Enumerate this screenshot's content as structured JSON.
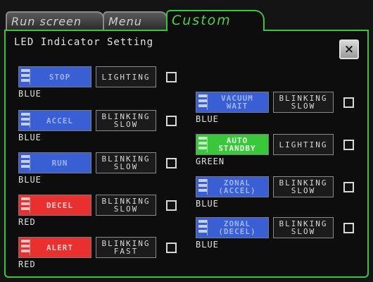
{
  "tabs": [
    {
      "label": "Run screen"
    },
    {
      "label": "Menu"
    },
    {
      "label": "Custom"
    }
  ],
  "panel": {
    "title": "LED Indicator Setting",
    "close_label": "×"
  },
  "left_column": [
    {
      "name": "STOP",
      "mode": "LIGHTING",
      "color": "BLUE",
      "swatch": "#3a5fd4",
      "checked": false
    },
    {
      "name": "ACCEL",
      "mode": "BLINKING\nSLOW",
      "color": "BLUE",
      "swatch": "#3a5fd4",
      "checked": false
    },
    {
      "name": "RUN",
      "mode": "BLINKING\nSLOW",
      "color": "BLUE",
      "swatch": "#3a5fd4",
      "checked": false
    },
    {
      "name": "DECEL",
      "mode": "BLINKING\nSLOW",
      "color": "RED",
      "swatch": "#ea2f2f",
      "checked": false
    },
    {
      "name": "ALERT",
      "mode": "BLINKING\nFAST",
      "color": "RED",
      "swatch": "#ea2f2f",
      "checked": false
    }
  ],
  "right_column": [
    {
      "name": "VACUUM\nWAIT",
      "mode": "BLINKING\nSLOW",
      "color": "BLUE",
      "swatch": "#3a5fd4",
      "checked": false
    },
    {
      "name": "AUTO\nSTANDBY",
      "mode": "LIGHTING",
      "color": "GREEN",
      "swatch": "#39c83a",
      "checked": false
    },
    {
      "name": "ZONAL\n(ACCEL)",
      "mode": "BLINKING\nSLOW",
      "color": "BLUE",
      "swatch": "#3a5fd4",
      "checked": false
    },
    {
      "name": "ZONAL\n(DECEL)",
      "mode": "BLINKING\nSLOW",
      "color": "BLUE",
      "swatch": "#3a5fd4",
      "checked": false
    }
  ],
  "accent_color": "#3cc43c"
}
